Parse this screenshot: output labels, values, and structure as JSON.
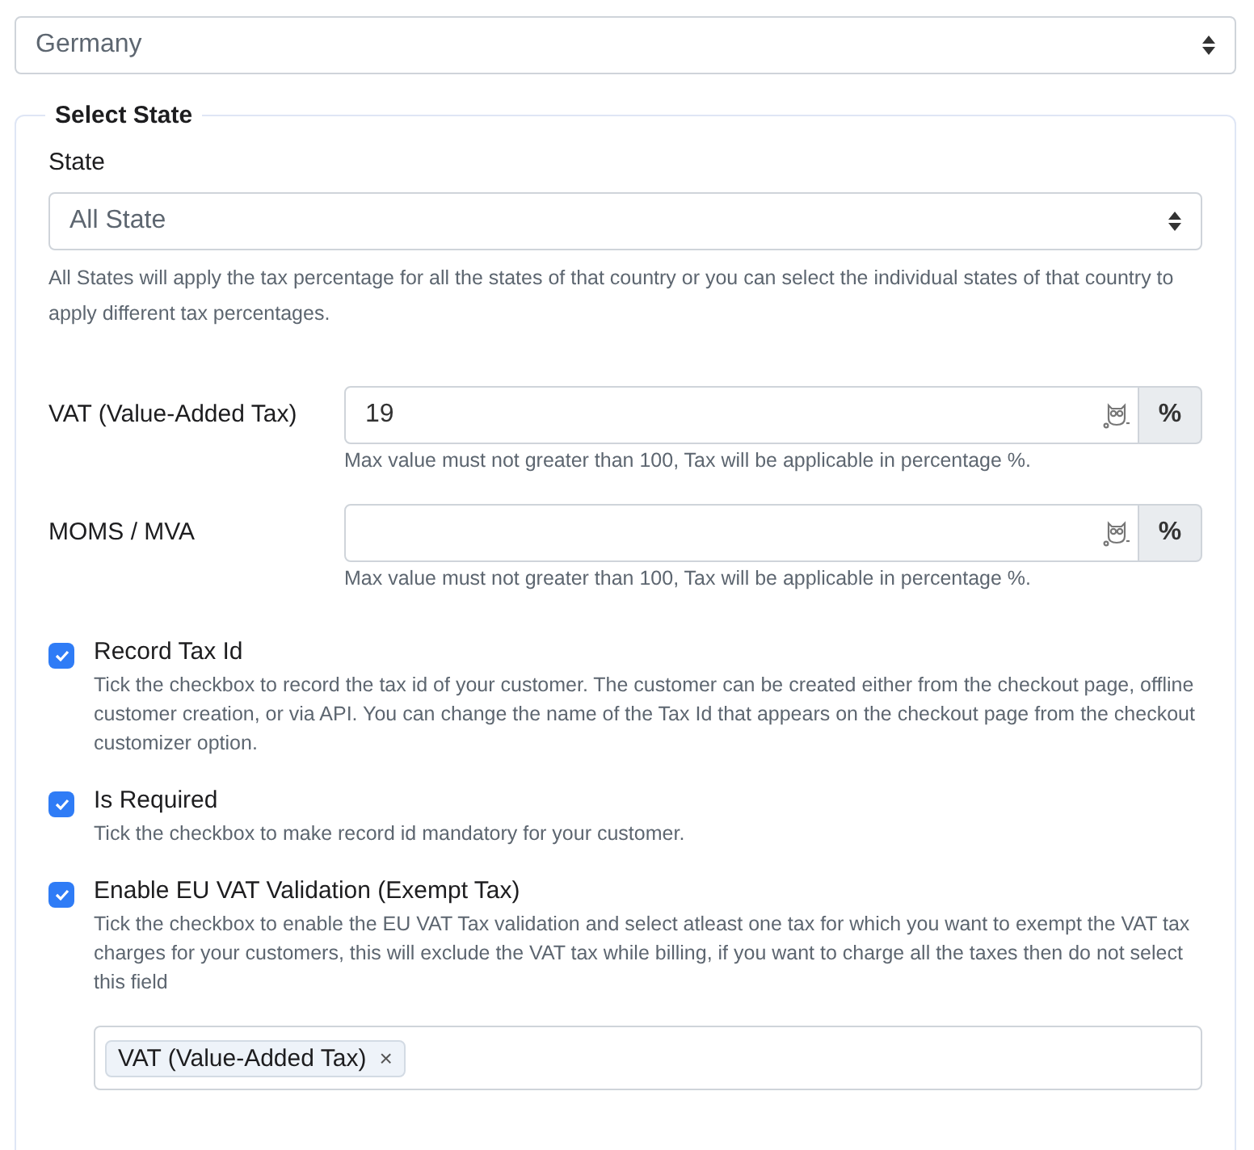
{
  "country_select": {
    "value": "Germany"
  },
  "state_section": {
    "legend": "Select State",
    "state_label": "State",
    "state_select": {
      "value": "All State"
    },
    "help": "All States will apply the tax percentage for all the states of that country or you can select the individual states of that country to apply different tax percentages."
  },
  "tax_fields": [
    {
      "label": "VAT (Value-Added Tax)",
      "value": "19",
      "addon": "%",
      "help": "Max value must not greater than 100, Tax will be applicable in percentage %."
    },
    {
      "label": "MOMS / MVA",
      "addon": "%",
      "help": "Max value must not greater than 100, Tax will be applicable in percentage %."
    }
  ],
  "checkboxes": [
    {
      "label": "Record Tax Id",
      "checked": true,
      "description": "Tick the checkbox to record the tax id of your customer. The customer can be created either from the checkout page, offline customer creation, or via API. You can change the name of the Tax Id that appears on the checkout page from the checkout customizer option."
    },
    {
      "label": "Is Required",
      "checked": true,
      "description": "Tick the checkbox to make record id mandatory for your customer."
    },
    {
      "label": "Enable EU VAT Validation (Exempt Tax)",
      "checked": true,
      "description": "Tick the checkbox to enable the EU VAT Tax validation and select atleast one tax for which you want to exempt the VAT tax charges for your customers, this will exclude the VAT tax while billing, if you want to charge all the taxes then do not select this field"
    }
  ],
  "exempt_tags": [
    {
      "label": "VAT (Value-Added Tax)",
      "remove": "×"
    }
  ]
}
